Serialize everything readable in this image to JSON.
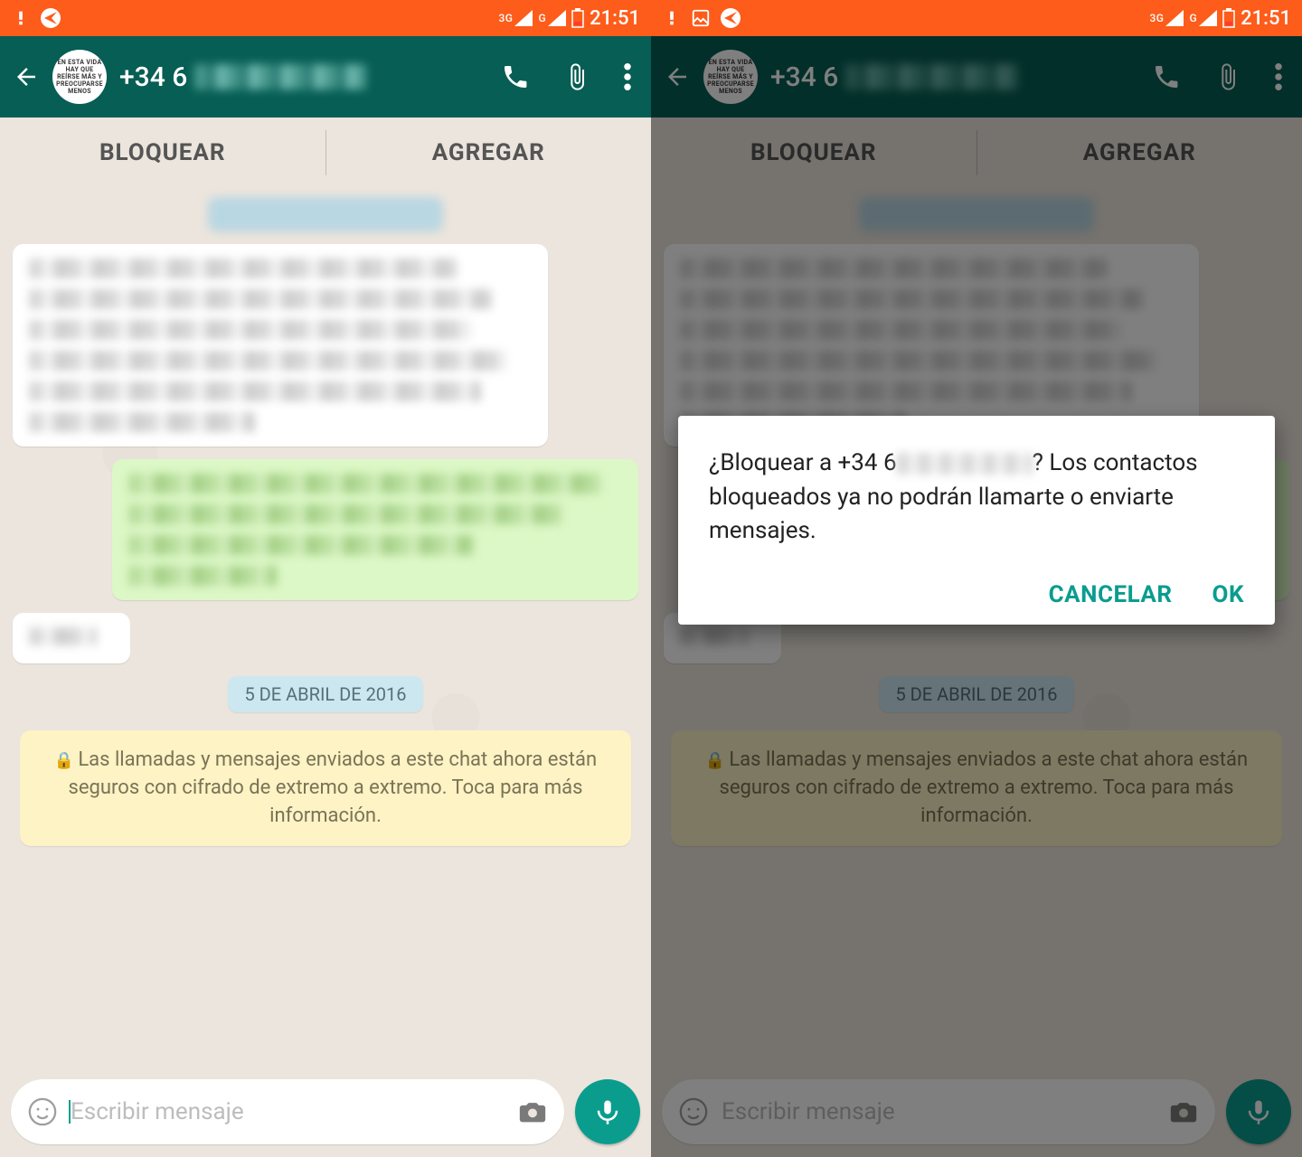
{
  "status": {
    "time": "21:51",
    "battery_icon": "battery-low-icon",
    "net1_label": "3G",
    "net2_label": "G"
  },
  "header": {
    "contact_prefix": "+34 6",
    "avatar_text": "EN ESTA VIDA HAY QUE REÍRSE MÁS Y PREOCUPARSE MENOS"
  },
  "block_bar": {
    "block_label": "BLOQUEAR",
    "add_label": "AGREGAR"
  },
  "chat": {
    "date_label": "5 DE ABRIL DE 2016",
    "encryption_text": "Las llamadas y mensajes enviados a este chat ahora están seguros con cifrado de extremo a extremo. Toca para más información."
  },
  "input": {
    "placeholder": "Escribir mensaje"
  },
  "dialog": {
    "text_prefix": "¿Bloquear a +34 6",
    "text_suffix": "? Los contactos bloqueados ya no podrán llamarte o enviarte mensajes.",
    "cancel_label": "CANCELAR",
    "ok_label": "OK"
  }
}
